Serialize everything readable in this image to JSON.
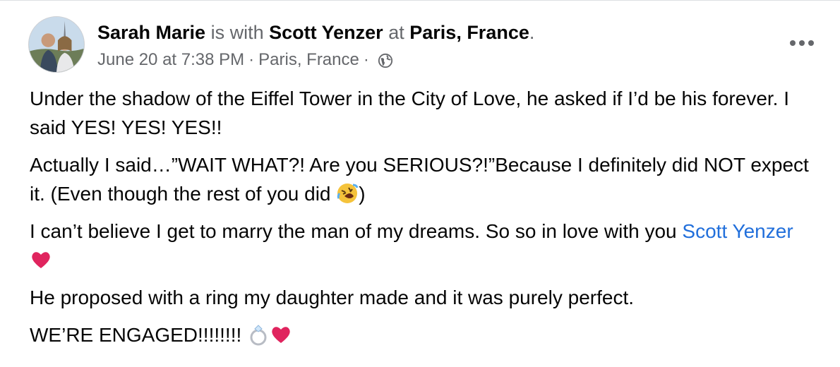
{
  "post": {
    "author": "Sarah Marie",
    "is_with_text": "is with",
    "tagged_person": "Scott Yenzer",
    "at_text": "at",
    "location": "Paris, France",
    "period": ".",
    "timestamp": "June 20 at 7:38 PM",
    "meta_sep": "·",
    "meta_location": "Paris, France",
    "privacy_icon": "globe-icon",
    "more_icon": "more-options-icon",
    "paragraphs": {
      "p1": "Under the shadow of the Eiffel Tower in the City of Love, he asked if I’d be his forever. I said YES! YES! YES!!",
      "p2_text": "Actually I said…”WAIT WHAT?! Are you SERIOUS?!”Because I definitely did NOT expect it. (Even though the rest of you did",
      "p2_emoji": "rolling-on-floor-laughing-emoji",
      "p2_close": ")",
      "p3_text": "I can’t believe I get to marry the man of my dreams. So so in love with you",
      "p3_link": "Scott Yenzer",
      "p3_emoji": "red-heart-emoji",
      "p4": "He proposed with a ring my daughter made and it was purely perfect.",
      "p5_text": "WE’RE ENGAGED!!!!!!!!",
      "p5_emojis": [
        "ring-emoji",
        "red-heart-emoji"
      ]
    }
  },
  "colors": {
    "link": "#216fdb",
    "muted": "#65676b",
    "heart": "#e0245e"
  }
}
